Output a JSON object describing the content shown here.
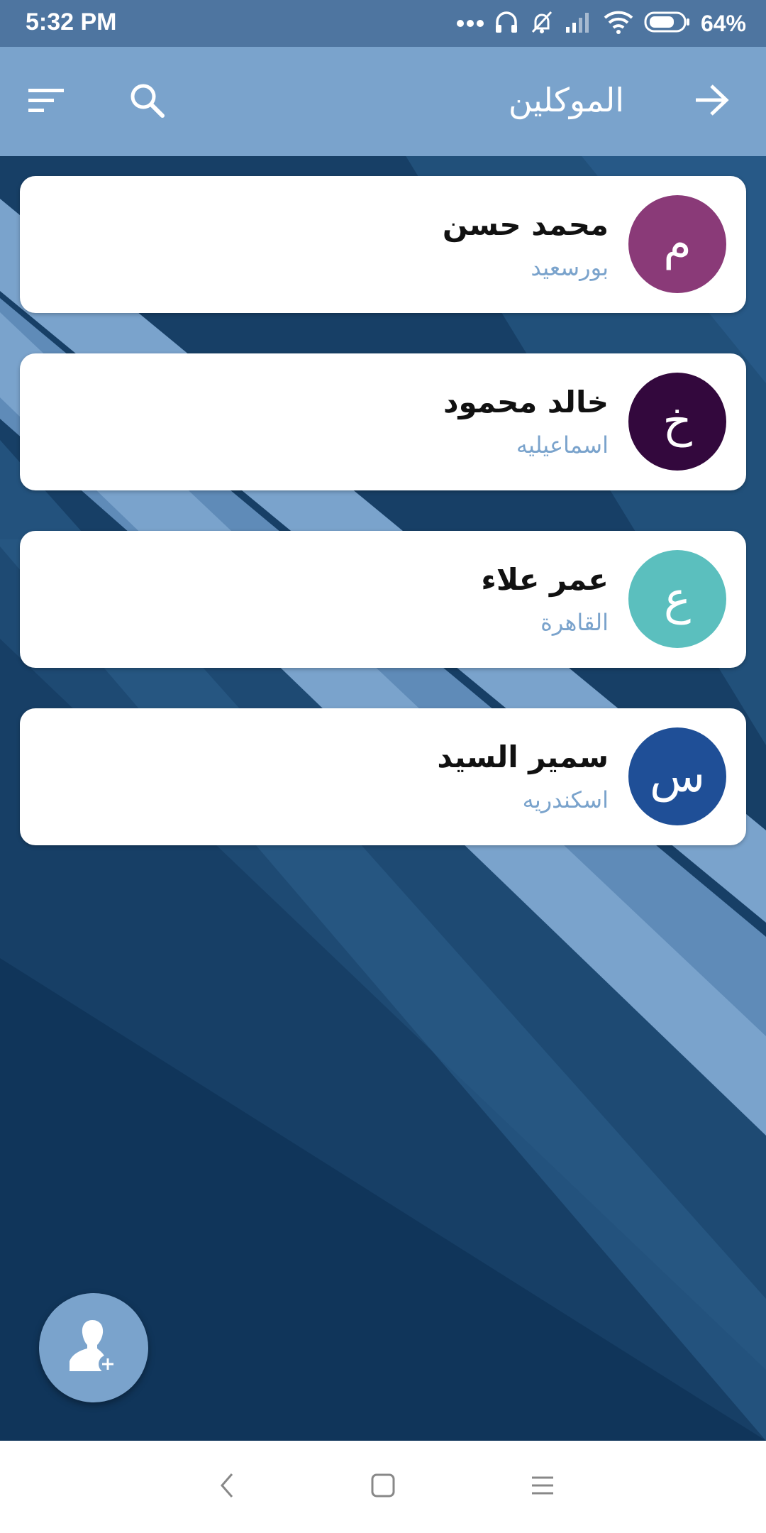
{
  "status_bar": {
    "time": "5:32 PM",
    "battery_percent": "64%",
    "icons": [
      "more-dots-icon",
      "headphones-icon",
      "bell-muted-icon",
      "signal-icon",
      "wifi-icon",
      "battery-icon"
    ]
  },
  "app_bar": {
    "title": "الموكلين",
    "icons": [
      "back-arrow-icon",
      "search-icon",
      "sort-icon"
    ]
  },
  "clients": [
    {
      "initial": "م",
      "name": "محمد حسن",
      "city": "بورسعيد",
      "color": "#8a3a78"
    },
    {
      "initial": "خ",
      "name": "خالد محمود",
      "city": "اسماعيليه",
      "color": "#33083d"
    },
    {
      "initial": "ع",
      "name": "عمر علاء",
      "city": "القاهرة",
      "color": "#5bbfbe"
    },
    {
      "initial": "س",
      "name": "سمير السيد",
      "city": "اسكندريه",
      "color": "#1f4f97"
    }
  ],
  "fab": {
    "icon": "add-user-icon"
  },
  "nav_bar": {
    "icons": [
      "nav-back-icon",
      "nav-home-icon",
      "nav-menu-icon"
    ]
  },
  "colors": {
    "status_bar": "#4e75a0",
    "app_bar": "#7aa3cc",
    "background_dark": "#173f66",
    "stripe_light": "#7aa3cc",
    "city_text": "#7aa3cc"
  }
}
